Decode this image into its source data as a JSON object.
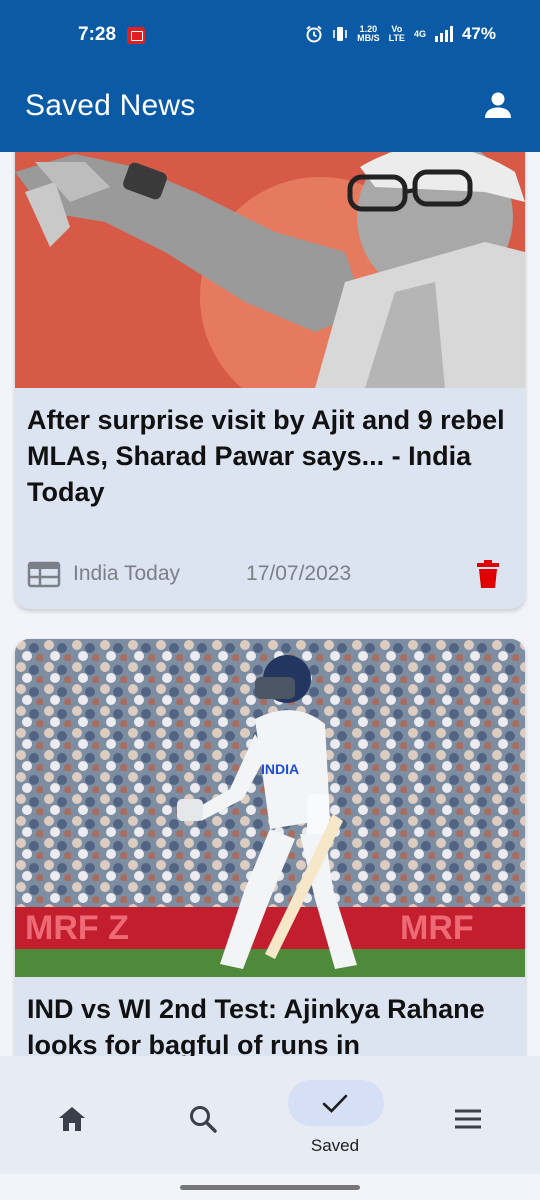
{
  "status_bar": {
    "time": "7:28",
    "net_speed_top": "1.20",
    "net_speed_bottom": "MB/S",
    "volte_top": "Vo",
    "volte_bottom": "LTE",
    "network_type": "4G",
    "battery": "47%"
  },
  "app_bar": {
    "title": "Saved News",
    "profile_icon": "account-icon"
  },
  "articles": [
    {
      "title": "After surprise visit by Ajit and 9 rebel MLAs, Sharad Pawar says... - India Today",
      "source": "India Today",
      "date": "17/07/2023",
      "image_icon": "article-image-politician",
      "delete_icon": "trash-icon"
    },
    {
      "title": "IND vs WI 2nd Test: Ajinkya Rahane looks for bagful of runs in",
      "source": "",
      "date": "",
      "image_icon": "article-image-cricketer"
    }
  ],
  "bottom_nav": {
    "items": [
      {
        "icon": "home-icon",
        "label": ""
      },
      {
        "icon": "search-icon",
        "label": ""
      },
      {
        "icon": "check-icon",
        "label": "Saved"
      },
      {
        "icon": "menu-icon",
        "label": ""
      }
    ]
  },
  "colors": {
    "primary": "#0a5aa6",
    "card_bg": "#dde4f1",
    "delete": "#e00000",
    "nav_active_pill": "#d5dff6"
  }
}
